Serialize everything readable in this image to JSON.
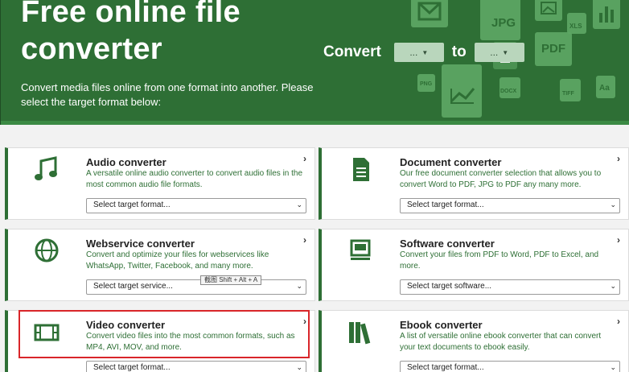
{
  "hero": {
    "title_line1": "Free online file",
    "title_line2": "converter",
    "subtitle": "Convert media files online from one format into another. Please select the target format below:",
    "convert_label": "Convert",
    "to_label": "to",
    "from_select": "...",
    "to_select": "...",
    "deco_labels": {
      "jpg": "JPG",
      "pdf": "PDF",
      "xls": "XLS",
      "png": "PNG",
      "docx": "DOCX",
      "tiff": "TIFF",
      "aa": "Aa"
    }
  },
  "cards": [
    {
      "title": "Audio converter",
      "desc": "A versatile online audio converter to convert audio files in the most common audio file formats.",
      "select": "Select target format...",
      "icon": "music-note-icon"
    },
    {
      "title": "Document converter",
      "desc": "Our free document converter selection that allows you to convert Word to PDF, JPG to PDF any many more.",
      "select": "Select target format...",
      "icon": "document-icon"
    },
    {
      "title": "Webservice converter",
      "desc": "Convert and optimize your files for webservices like WhatsApp, Twitter, Facebook, and many more.",
      "select": "Select target service...",
      "icon": "globe-icon"
    },
    {
      "title": "Software converter",
      "desc": "Convert your files from PDF to Word, PDF to Excel, and more.",
      "select": "Select target software...",
      "icon": "monitor-icon"
    },
    {
      "title": "Video converter",
      "desc": "Convert video files into the most common formats, such as MP4, AVI, MOV, and more.",
      "select": "Select target format...",
      "icon": "film-icon"
    },
    {
      "title": "Ebook converter",
      "desc": "A list of versatile online ebook converter that can convert your text documents to ebook easily.",
      "select": "Select target format...",
      "icon": "books-icon"
    }
  ],
  "tooltip": "截图 Shift + Alt + A",
  "arrow": "›",
  "caret": "⌄",
  "colors": {
    "brand": "#2e6f35",
    "highlight": "#d9262a"
  }
}
